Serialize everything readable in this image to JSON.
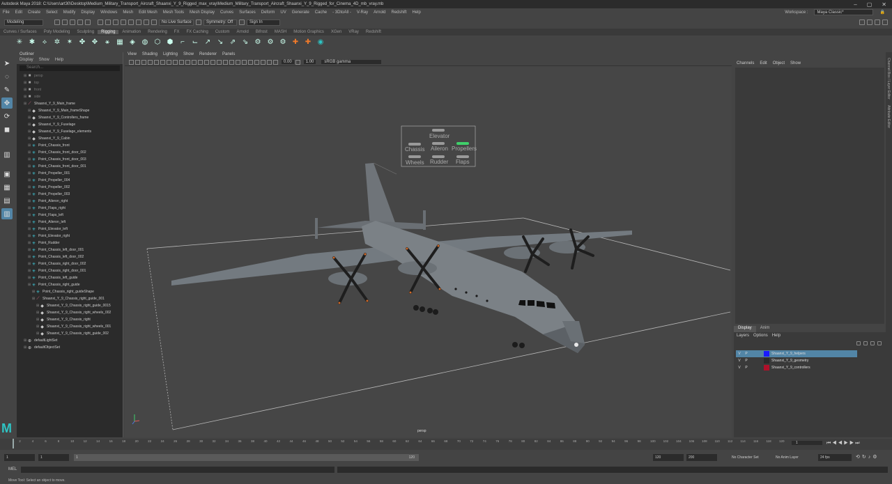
{
  "title": "Autodesk Maya 2018: C:\\Users\\art30\\Desktop\\Medium_Military_Transport_Aircraft_Shaanxi_Y_9_Rigged_max_vray\\Medium_Military_Transport_Aircraft_Shaanxi_Y_9_Rigged_for_Cinema_4D_mb_vray.mb",
  "menus": [
    "File",
    "Edit",
    "Create",
    "Select",
    "Modify",
    "Display",
    "Windows",
    "Mesh",
    "Edit Mesh",
    "Mesh Tools",
    "Mesh Display",
    "Curves",
    "Surfaces",
    "Deform",
    "UV",
    "Generate",
    "Cache",
    "- 3DtoAll -",
    "V-Ray",
    "Arnold",
    "Redshift",
    "Help"
  ],
  "workspace_label": "Workspace :",
  "workspace_value": "Maya Classic*",
  "status": {
    "mode": "Modeling",
    "live": "No Live Surface",
    "symmetry": "Symmetry: Off",
    "signin": "Sign In"
  },
  "shelf_tabs": [
    "Curves / Surfaces",
    "Poly Modeling",
    "Sculpting",
    "Rigging",
    "Animation",
    "Rendering",
    "FX",
    "FX Caching",
    "Custom",
    "Arnold",
    "Bifrost",
    "MASH",
    "Motion Graphics",
    "XGen",
    "VRay",
    "Redshift"
  ],
  "active_shelf": "Rigging",
  "outliner": {
    "title": "Outliner",
    "menu": [
      "Display",
      "Show",
      "Help"
    ],
    "search": "Search...",
    "items": [
      {
        "name": "persp",
        "icon": "camera",
        "indent": 1,
        "dim": true
      },
      {
        "name": "top",
        "icon": "camera",
        "indent": 1,
        "dim": true
      },
      {
        "name": "front",
        "icon": "camera",
        "indent": 1,
        "dim": true
      },
      {
        "name": "side",
        "icon": "camera",
        "indent": 1,
        "dim": true
      },
      {
        "name": "Shaanxi_Y_9_Main_frame",
        "icon": "joint",
        "indent": 1
      },
      {
        "name": "Shaanxi_Y_9_Main_frameShape",
        "icon": "shape",
        "indent": 2
      },
      {
        "name": "Shaanxi_Y_9_Controllers_frame",
        "icon": "shape",
        "indent": 2
      },
      {
        "name": "Shaanxi_Y_9_Fuselage",
        "icon": "shape",
        "indent": 2
      },
      {
        "name": "Shaanxi_Y_9_Fuselage_elements",
        "icon": "shape",
        "indent": 2
      },
      {
        "name": "Shaanxi_Y_9_Cabin",
        "icon": "shape",
        "indent": 2
      },
      {
        "name": "Point_Chassis_front",
        "icon": "point",
        "indent": 2
      },
      {
        "name": "Point_Chassis_front_door_002",
        "icon": "point",
        "indent": 2
      },
      {
        "name": "Point_Chassis_front_door_003",
        "icon": "point",
        "indent": 2
      },
      {
        "name": "Point_Chassis_front_door_001",
        "icon": "point",
        "indent": 2
      },
      {
        "name": "Point_Propeller_001",
        "icon": "point",
        "indent": 2
      },
      {
        "name": "Point_Propeller_004",
        "icon": "point",
        "indent": 2
      },
      {
        "name": "Point_Propeller_002",
        "icon": "point",
        "indent": 2
      },
      {
        "name": "Point_Propeller_003",
        "icon": "point",
        "indent": 2
      },
      {
        "name": "Point_Aileron_right",
        "icon": "point",
        "indent": 2
      },
      {
        "name": "Point_Flaps_right",
        "icon": "point",
        "indent": 2
      },
      {
        "name": "Point_Flaps_left",
        "icon": "point",
        "indent": 2
      },
      {
        "name": "Point_Aileron_left",
        "icon": "point",
        "indent": 2
      },
      {
        "name": "Point_Elevator_left",
        "icon": "point",
        "indent": 2
      },
      {
        "name": "Point_Elevator_right",
        "icon": "point",
        "indent": 2
      },
      {
        "name": "Point_Rudder",
        "icon": "point",
        "indent": 2
      },
      {
        "name": "Point_Chassis_left_door_001",
        "icon": "point",
        "indent": 2
      },
      {
        "name": "Point_Chassis_left_door_002",
        "icon": "point",
        "indent": 2
      },
      {
        "name": "Point_Chassis_right_door_002",
        "icon": "point",
        "indent": 2
      },
      {
        "name": "Point_Chassis_right_door_001",
        "icon": "point",
        "indent": 2
      },
      {
        "name": "Point_Chassis_left_guide",
        "icon": "point",
        "indent": 2
      },
      {
        "name": "Point_Chassis_right_guide",
        "icon": "point",
        "indent": 2
      },
      {
        "name": "Point_Chassis_right_guideShape",
        "icon": "point",
        "indent": 3
      },
      {
        "name": "Shaanxi_Y_9_Chassis_right_guide_001",
        "icon": "joint",
        "indent": 3
      },
      {
        "name": "Shaanxi_Y_9_Chassis_right_guide_0015",
        "icon": "shape",
        "indent": 4
      },
      {
        "name": "Shaanxi_Y_9_Chassis_right_wheels_002",
        "icon": "shape",
        "indent": 4
      },
      {
        "name": "Shaanxi_Y_9_Chassis_right",
        "icon": "shape",
        "indent": 4
      },
      {
        "name": "Shaanxi_Y_9_Chassis_right_wheels_001",
        "icon": "shape",
        "indent": 4
      },
      {
        "name": "Shaanxi_Y_9_Chassis_right_guide_002",
        "icon": "shape",
        "indent": 4
      },
      {
        "name": "defaultLightSet",
        "icon": "set",
        "indent": 1
      },
      {
        "name": "defaultObjectSet",
        "icon": "set",
        "indent": 1
      }
    ]
  },
  "viewport": {
    "menu": [
      "View",
      "Shading",
      "Lighting",
      "Show",
      "Renderer",
      "Panels"
    ],
    "num1": "0.00",
    "num2": "1.00",
    "colorspace": "sRGB gamma",
    "camera": "persp",
    "ctrl_labels": {
      "elevator": "Elevator",
      "chassis": "Chassis",
      "aileron": "Aileron",
      "propellers": "Propellers",
      "wheels": "Wheels",
      "rudder": "Rudder",
      "flaps": "Flaps"
    }
  },
  "channel_box": {
    "menu": [
      "Channels",
      "Edit",
      "Object",
      "Show"
    ]
  },
  "side_tabs": [
    "Channel Box / Layer Editor",
    "Attribute Editor"
  ],
  "layer_editor": {
    "tabs": [
      "Display",
      "Anim"
    ],
    "menu": [
      "Layers",
      "Options",
      "Help"
    ],
    "layers": [
      {
        "v": "V",
        "p": "P",
        "name": "Shaanxi_Y_9_helpers",
        "color": "#1a1aff",
        "selected": true
      },
      {
        "v": "V",
        "p": "P",
        "name": "Shaanxi_Y_9_geometry",
        "color": "#2b2b2b",
        "selected": false
      },
      {
        "v": "V",
        "p": "P",
        "name": "Shaanxi_Y_9_controllers",
        "color": "#b0102a",
        "selected": false
      }
    ]
  },
  "timeline": {
    "current_frame": "1",
    "ticks": [
      "1",
      "2",
      "4",
      "6",
      "8",
      "10",
      "12",
      "14",
      "16",
      "18",
      "20",
      "22",
      "24",
      "26",
      "28",
      "30",
      "32",
      "34",
      "36",
      "38",
      "40",
      "42",
      "44",
      "46",
      "48",
      "50",
      "52",
      "54",
      "56",
      "58",
      "60",
      "62",
      "64",
      "66",
      "68",
      "70",
      "72",
      "74",
      "76",
      "78",
      "80",
      "82",
      "84",
      "86",
      "88",
      "90",
      "92",
      "94",
      "96",
      "98",
      "100",
      "102",
      "104",
      "106",
      "108",
      "110",
      "112",
      "114",
      "116",
      "118",
      "120"
    ]
  },
  "range": {
    "start": "1",
    "anim_start": "1",
    "slider_start": "1",
    "slider_end": "120",
    "end": "120",
    "anim_end": "200",
    "char_set": "No Character Set",
    "anim_layer": "No Anim Layer",
    "fps": "24 fps"
  },
  "mel_label": "MEL",
  "help_line": "Move Tool: Select an object to move."
}
